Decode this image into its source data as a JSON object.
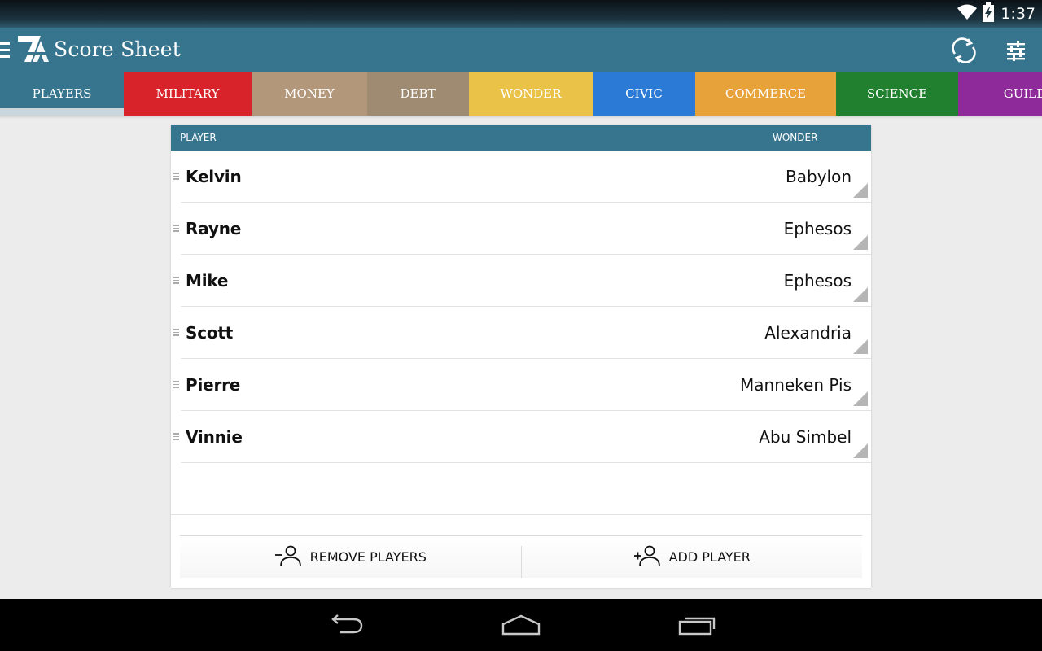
{
  "status": {
    "time": "1:37"
  },
  "app": {
    "title": "Score Sheet"
  },
  "tabs": [
    {
      "label": "PLAYERS",
      "color": "#37758f",
      "active": true
    },
    {
      "label": "MILITARY",
      "color": "#d9232a"
    },
    {
      "label": "MONEY",
      "color": "#b3977a"
    },
    {
      "label": "DEBT",
      "color": "#9f8a72"
    },
    {
      "label": "WONDER",
      "color": "#e9c247"
    },
    {
      "label": "CIVIC",
      "color": "#2b7bd6"
    },
    {
      "label": "COMMERCE",
      "color": "#e8a23a"
    },
    {
      "label": "SCIENCE",
      "color": "#21802f"
    },
    {
      "label": "GUILD",
      "color": "#8e2a9a"
    }
  ],
  "table": {
    "header_player": "PLAYER",
    "header_wonder": "WONDER",
    "rows": [
      {
        "player": "Kelvin",
        "wonder": "Babylon"
      },
      {
        "player": "Rayne",
        "wonder": "Ephesos"
      },
      {
        "player": "Mike",
        "wonder": "Ephesos"
      },
      {
        "player": "Scott",
        "wonder": "Alexandria"
      },
      {
        "player": "Pierre",
        "wonder": "Manneken Pis"
      },
      {
        "player": "Vinnie",
        "wonder": "Abu Simbel"
      }
    ]
  },
  "buttons": {
    "remove": "REMOVE PLAYERS",
    "add": "ADD PLAYER"
  },
  "icons": {
    "menu": "hamburger-icon",
    "logo": "7a-logo-icon",
    "sync": "sync-icon",
    "settings": "sliders-icon",
    "wifi": "wifi-icon",
    "battery": "battery-charging-icon",
    "back": "back-icon",
    "home": "home-icon",
    "recents": "recents-icon"
  }
}
